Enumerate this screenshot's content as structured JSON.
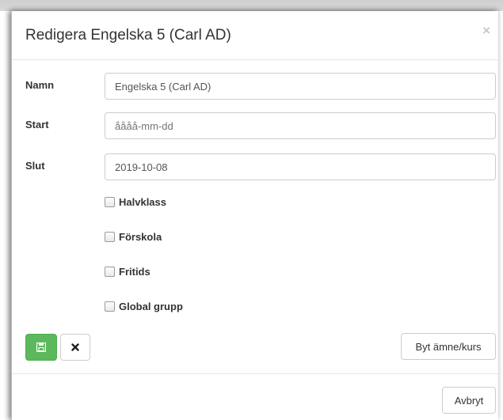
{
  "modal": {
    "title": "Redigera Engelska 5 (Carl AD)",
    "close_symbol": "×"
  },
  "form": {
    "fields": [
      {
        "label": "Namn",
        "value": "Engelska 5 (Carl AD)",
        "placeholder": ""
      },
      {
        "label": "Start",
        "value": "",
        "placeholder": "åååå-mm-dd"
      },
      {
        "label": "Slut",
        "value": "2019-10-08",
        "placeholder": ""
      }
    ],
    "checkboxes": [
      {
        "label": "Halvklass",
        "checked": false
      },
      {
        "label": "Förskola",
        "checked": false
      },
      {
        "label": "Fritids",
        "checked": false
      },
      {
        "label": "Global grupp",
        "checked": false
      }
    ]
  },
  "actions": {
    "save_icon": "floppy-disk-icon",
    "delete_icon": "times-icon",
    "change_subject_label": "Byt ämne/kurs"
  },
  "footer": {
    "cancel_label": "Avbryt"
  },
  "colors": {
    "save_button_bg": "#5cb85c",
    "text": "#333333"
  }
}
